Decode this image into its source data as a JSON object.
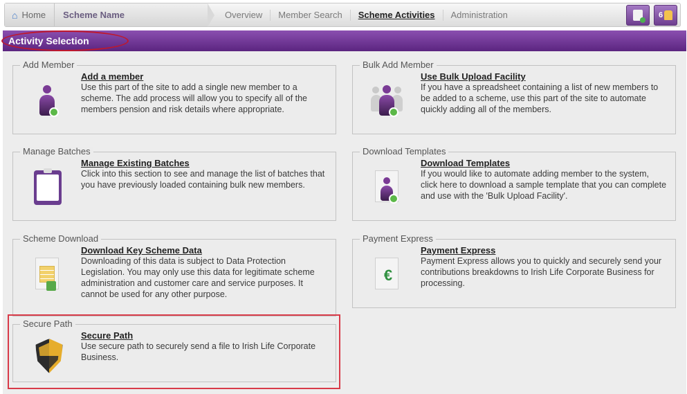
{
  "nav": {
    "home": "Home",
    "scheme": "Scheme Name",
    "tabs": [
      {
        "label": "Overview",
        "active": false
      },
      {
        "label": "Member Search",
        "active": false
      },
      {
        "label": "Scheme Activities",
        "active": true
      },
      {
        "label": "Administration",
        "active": false
      }
    ],
    "notification_count": "6"
  },
  "header": {
    "title": "Activity Selection"
  },
  "cards": {
    "add_member": {
      "legend": "Add Member",
      "link": "Add a member",
      "desc": "Use this part of the site to add a single new member to a scheme. The add process will allow you to specify all of the members pension and risk details where appropriate.",
      "icon": "add-person-icon"
    },
    "bulk_add": {
      "legend": "Bulk Add Member",
      "link": "Use Bulk Upload Facility",
      "desc": "If you have a spreadsheet containing a list of new members to be added to a scheme, use this part of the site to automate quickly adding all of the members.",
      "icon": "add-group-icon"
    },
    "manage_batches": {
      "legend": "Manage Batches",
      "link": "Manage Existing Batches",
      "desc": "Click into this section to see and manage the list of batches that you have previously loaded containing bulk new members.",
      "icon": "clipboard-icon"
    },
    "download_templates": {
      "legend": "Download Templates",
      "link": "Download Templates",
      "desc": "If you would like to automate adding member to the system, click here to download a sample template that you can complete and use with the 'Bulk Upload Facility'.",
      "icon": "template-download-icon"
    },
    "scheme_download": {
      "legend": "Scheme Download",
      "link": "Download Key Scheme Data",
      "desc": "Downloading of this data is subject to Data Protection Legislation. You may only use this data for legitimate scheme administration and customer care and service purposes. It cannot be used for any other purpose.",
      "icon": "spreadsheet-download-icon"
    },
    "payment_express": {
      "legend": "Payment Express",
      "link": "Payment Express",
      "desc": "Payment Express allows you to quickly and securely send your contributions breakdowns to Irish Life Corporate Business for processing.",
      "icon": "euro-document-icon"
    },
    "secure_path": {
      "legend": "Secure Path",
      "link": "Secure Path",
      "desc": "Use secure path to securely send a file to Irish Life Corporate Business.",
      "icon": "shield-icon"
    }
  },
  "colors": {
    "header_purple": "#6d3592",
    "annotation_red": "#c0182b"
  }
}
